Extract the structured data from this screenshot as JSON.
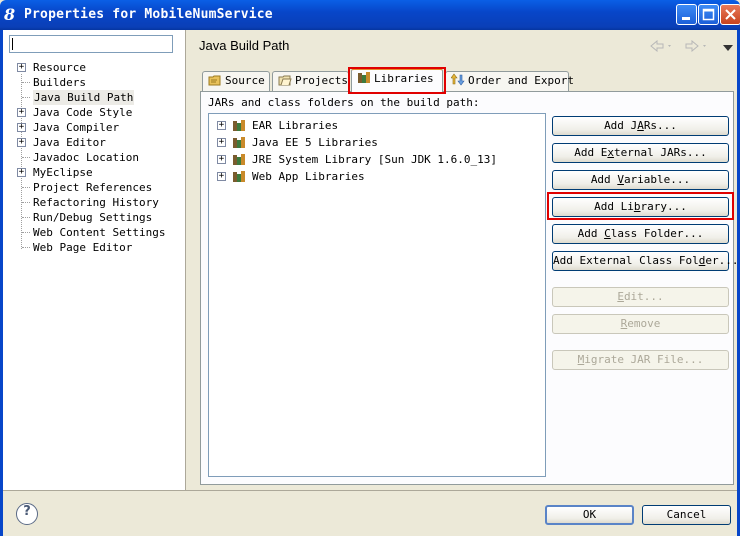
{
  "window": {
    "title": "Properties for MobileNumService"
  },
  "filter": {
    "value": ""
  },
  "tree": [
    {
      "label": "Resource",
      "expandable": true
    },
    {
      "label": "Builders",
      "expandable": false
    },
    {
      "label": "Java Build Path",
      "expandable": false,
      "selected": true
    },
    {
      "label": "Java Code Style",
      "expandable": true
    },
    {
      "label": "Java Compiler",
      "expandable": true
    },
    {
      "label": "Java Editor",
      "expandable": true
    },
    {
      "label": "Javadoc Location",
      "expandable": false
    },
    {
      "label": "MyEclipse",
      "expandable": true
    },
    {
      "label": "Project References",
      "expandable": false
    },
    {
      "label": "Refactoring History",
      "expandable": false
    },
    {
      "label": "Run/Debug Settings",
      "expandable": false
    },
    {
      "label": "Web Content Settings",
      "expandable": false
    },
    {
      "label": "Web Page Editor",
      "expandable": false
    }
  ],
  "page": {
    "title": "Java Build Path"
  },
  "tabs": [
    {
      "label": "Source",
      "icon": "source-folder-icon"
    },
    {
      "label": "Projects",
      "icon": "projects-folder-icon"
    },
    {
      "label": "Libraries",
      "icon": "libraries-icon",
      "active": true
    },
    {
      "label": "Order and Export",
      "icon": "order-export-icon"
    }
  ],
  "libraries": {
    "caption": "JARs and class folders on the build path:",
    "items": [
      "EAR Libraries",
      "Java EE 5 Libraries",
      "JRE System Library [Sun JDK 1.6.0_13]",
      "Web App Libraries"
    ]
  },
  "buttons": {
    "add_jars": "Add JARs...",
    "add_external_jars": "Add External JARs...",
    "add_variable": "Add Variable...",
    "add_library": "Add Library...",
    "add_class_folder": "Add Class Folder...",
    "add_external_class_folder": "Add External Class Folder...",
    "edit": "Edit...",
    "remove": "Remove",
    "migrate_jar": "Migrate JAR File..."
  },
  "dialog": {
    "ok": "OK",
    "cancel": "Cancel"
  },
  "colors": {
    "titlebar": "#0746c9",
    "highlight": "#e00000",
    "dialog_bg": "#ece9d8"
  }
}
